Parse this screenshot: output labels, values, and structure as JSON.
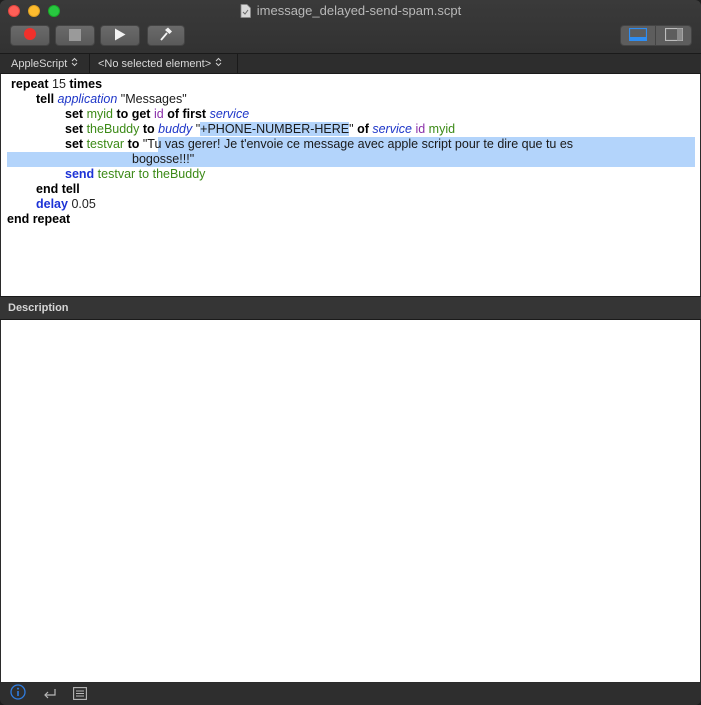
{
  "window": {
    "title": "imessage_delayed-send-spam.scpt"
  },
  "toolbar": {
    "buttons": [
      {
        "name": "record",
        "icon": "record-icon"
      },
      {
        "name": "stop",
        "icon": "stop-icon"
      },
      {
        "name": "run",
        "icon": "play-icon"
      },
      {
        "name": "compile",
        "icon": "hammer-icon"
      }
    ],
    "view_toggle": [
      "show-bottom-pane-icon",
      "show-sidebar-icon"
    ]
  },
  "navbar": {
    "language": "AppleScript",
    "element": "<No selected element>"
  },
  "code": {
    "l1": {
      "kw1": "repeat",
      "num": " 15 ",
      "kw2": "times"
    },
    "l2": {
      "kw1": "tell",
      "app": "application",
      "str": " \"Messages\""
    },
    "l3": {
      "kw1": "set",
      "var": "myid",
      "kw2": "to get",
      "prop": "id",
      "kw3": "of first",
      "app": "service"
    },
    "l4": {
      "kw1": "set",
      "var": "theBuddy",
      "kw2": "to",
      "app": "buddy",
      "q1": "\"",
      "sel": "+PHONE-NUMBER-HERE",
      "q2": "\"",
      "kw3": "of",
      "app2": "service",
      "prop": "id",
      "var2": "myid"
    },
    "l5": {
      "kw1": "set",
      "var": "testvar",
      "kw2": "to",
      "q": "\"",
      "str": "Tu vas gerer! Je t'envoie ce message avec apple script pour te dire que tu es"
    },
    "l6": {
      "str": "bogosse!!!",
      "q": "\""
    },
    "l7": {
      "kw1": "send",
      "var": "testvar",
      "kw2": "to",
      "var2": "theBuddy"
    },
    "l8": {
      "kw1": "end tell"
    },
    "l9": {
      "kw1": "delay",
      "num": " 0.05"
    },
    "l10": {
      "kw1": "end repeat"
    }
  },
  "description": {
    "header": "Description"
  },
  "bottom_bar": {
    "icons": [
      "info-icon",
      "return-icon",
      "list-icon"
    ],
    "accent": "#2f7de1"
  },
  "colors": {
    "keyword_blue": "#1d33d6",
    "variable_green": "#3c8a17",
    "property_purple": "#8a2fa8",
    "selection": "#b3d4fb"
  }
}
